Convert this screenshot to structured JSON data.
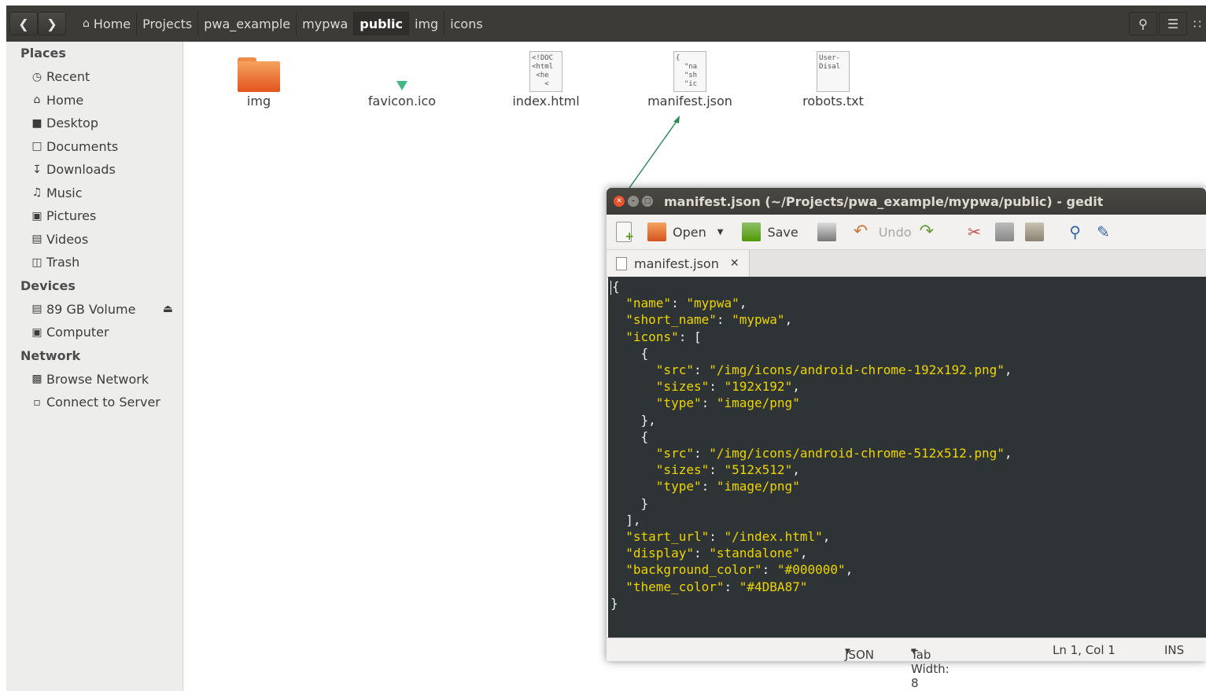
{
  "header": {
    "back_icon": "chevron-left-icon",
    "forward_icon": "chevron-right-icon",
    "breadcrumbs": [
      "Home",
      "Projects",
      "pwa_example",
      "mypwa",
      "public",
      "img",
      "icons"
    ],
    "active_crumb": "public"
  },
  "sidebar": {
    "places_title": "Places",
    "places": [
      {
        "label": "Recent",
        "icon": "clock-icon"
      },
      {
        "label": "Home",
        "icon": "home-icon"
      },
      {
        "label": "Desktop",
        "icon": "folder-icon"
      },
      {
        "label": "Documents",
        "icon": "document-icon"
      },
      {
        "label": "Downloads",
        "icon": "download-icon"
      },
      {
        "label": "Music",
        "icon": "music-icon"
      },
      {
        "label": "Pictures",
        "icon": "camera-icon"
      },
      {
        "label": "Videos",
        "icon": "film-icon"
      },
      {
        "label": "Trash",
        "icon": "trash-icon"
      }
    ],
    "devices_title": "Devices",
    "devices": [
      {
        "label": "89 GB Volume",
        "icon": "drive-icon"
      },
      {
        "label": "Computer",
        "icon": "computer-icon"
      }
    ],
    "network_title": "Network",
    "network": [
      {
        "label": "Browse Network",
        "icon": "network-icon"
      },
      {
        "label": "Connect to Server",
        "icon": "server-icon"
      }
    ]
  },
  "files": [
    {
      "name": "img",
      "type": "folder"
    },
    {
      "name": "favicon.ico",
      "type": "vue-icon"
    },
    {
      "name": "index.html",
      "type": "document",
      "preview": "<!DOC\n<html\n <he\n   <"
    },
    {
      "name": "manifest.json",
      "type": "document",
      "preview": "{\n  \"na\n  \"sh\n  \"ic"
    },
    {
      "name": "robots.txt",
      "type": "document",
      "preview": "User-\nDisal"
    }
  ],
  "gedit": {
    "title": "manifest.json (~/Projects/pwa_example/mypwa/public) - gedit",
    "toolbar": {
      "open_label": "Open",
      "save_label": "Save",
      "undo_label": "Undo"
    },
    "tab_label": "manifest.json",
    "code": [
      "{",
      "  \"name\": \"mypwa\",",
      "  \"short_name\": \"mypwa\",",
      "  \"icons\": [",
      "    {",
      "      \"src\": \"/img/icons/android-chrome-192x192.png\",",
      "      \"sizes\": \"192x192\",",
      "      \"type\": \"image/png\"",
      "    },",
      "    {",
      "      \"src\": \"/img/icons/android-chrome-512x512.png\",",
      "      \"sizes\": \"512x512\",",
      "      \"type\": \"image/png\"",
      "    }",
      "  ],",
      "  \"start_url\": \"/index.html\",",
      "  \"display\": \"standalone\",",
      "  \"background_color\": \"#000000\",",
      "  \"theme_color\": \"#4DBA87\"",
      "}"
    ],
    "status": {
      "language": "JSON",
      "tab_width": "Tab Width: 8",
      "position": "Ln 1, Col 1",
      "mode": "INS"
    }
  }
}
